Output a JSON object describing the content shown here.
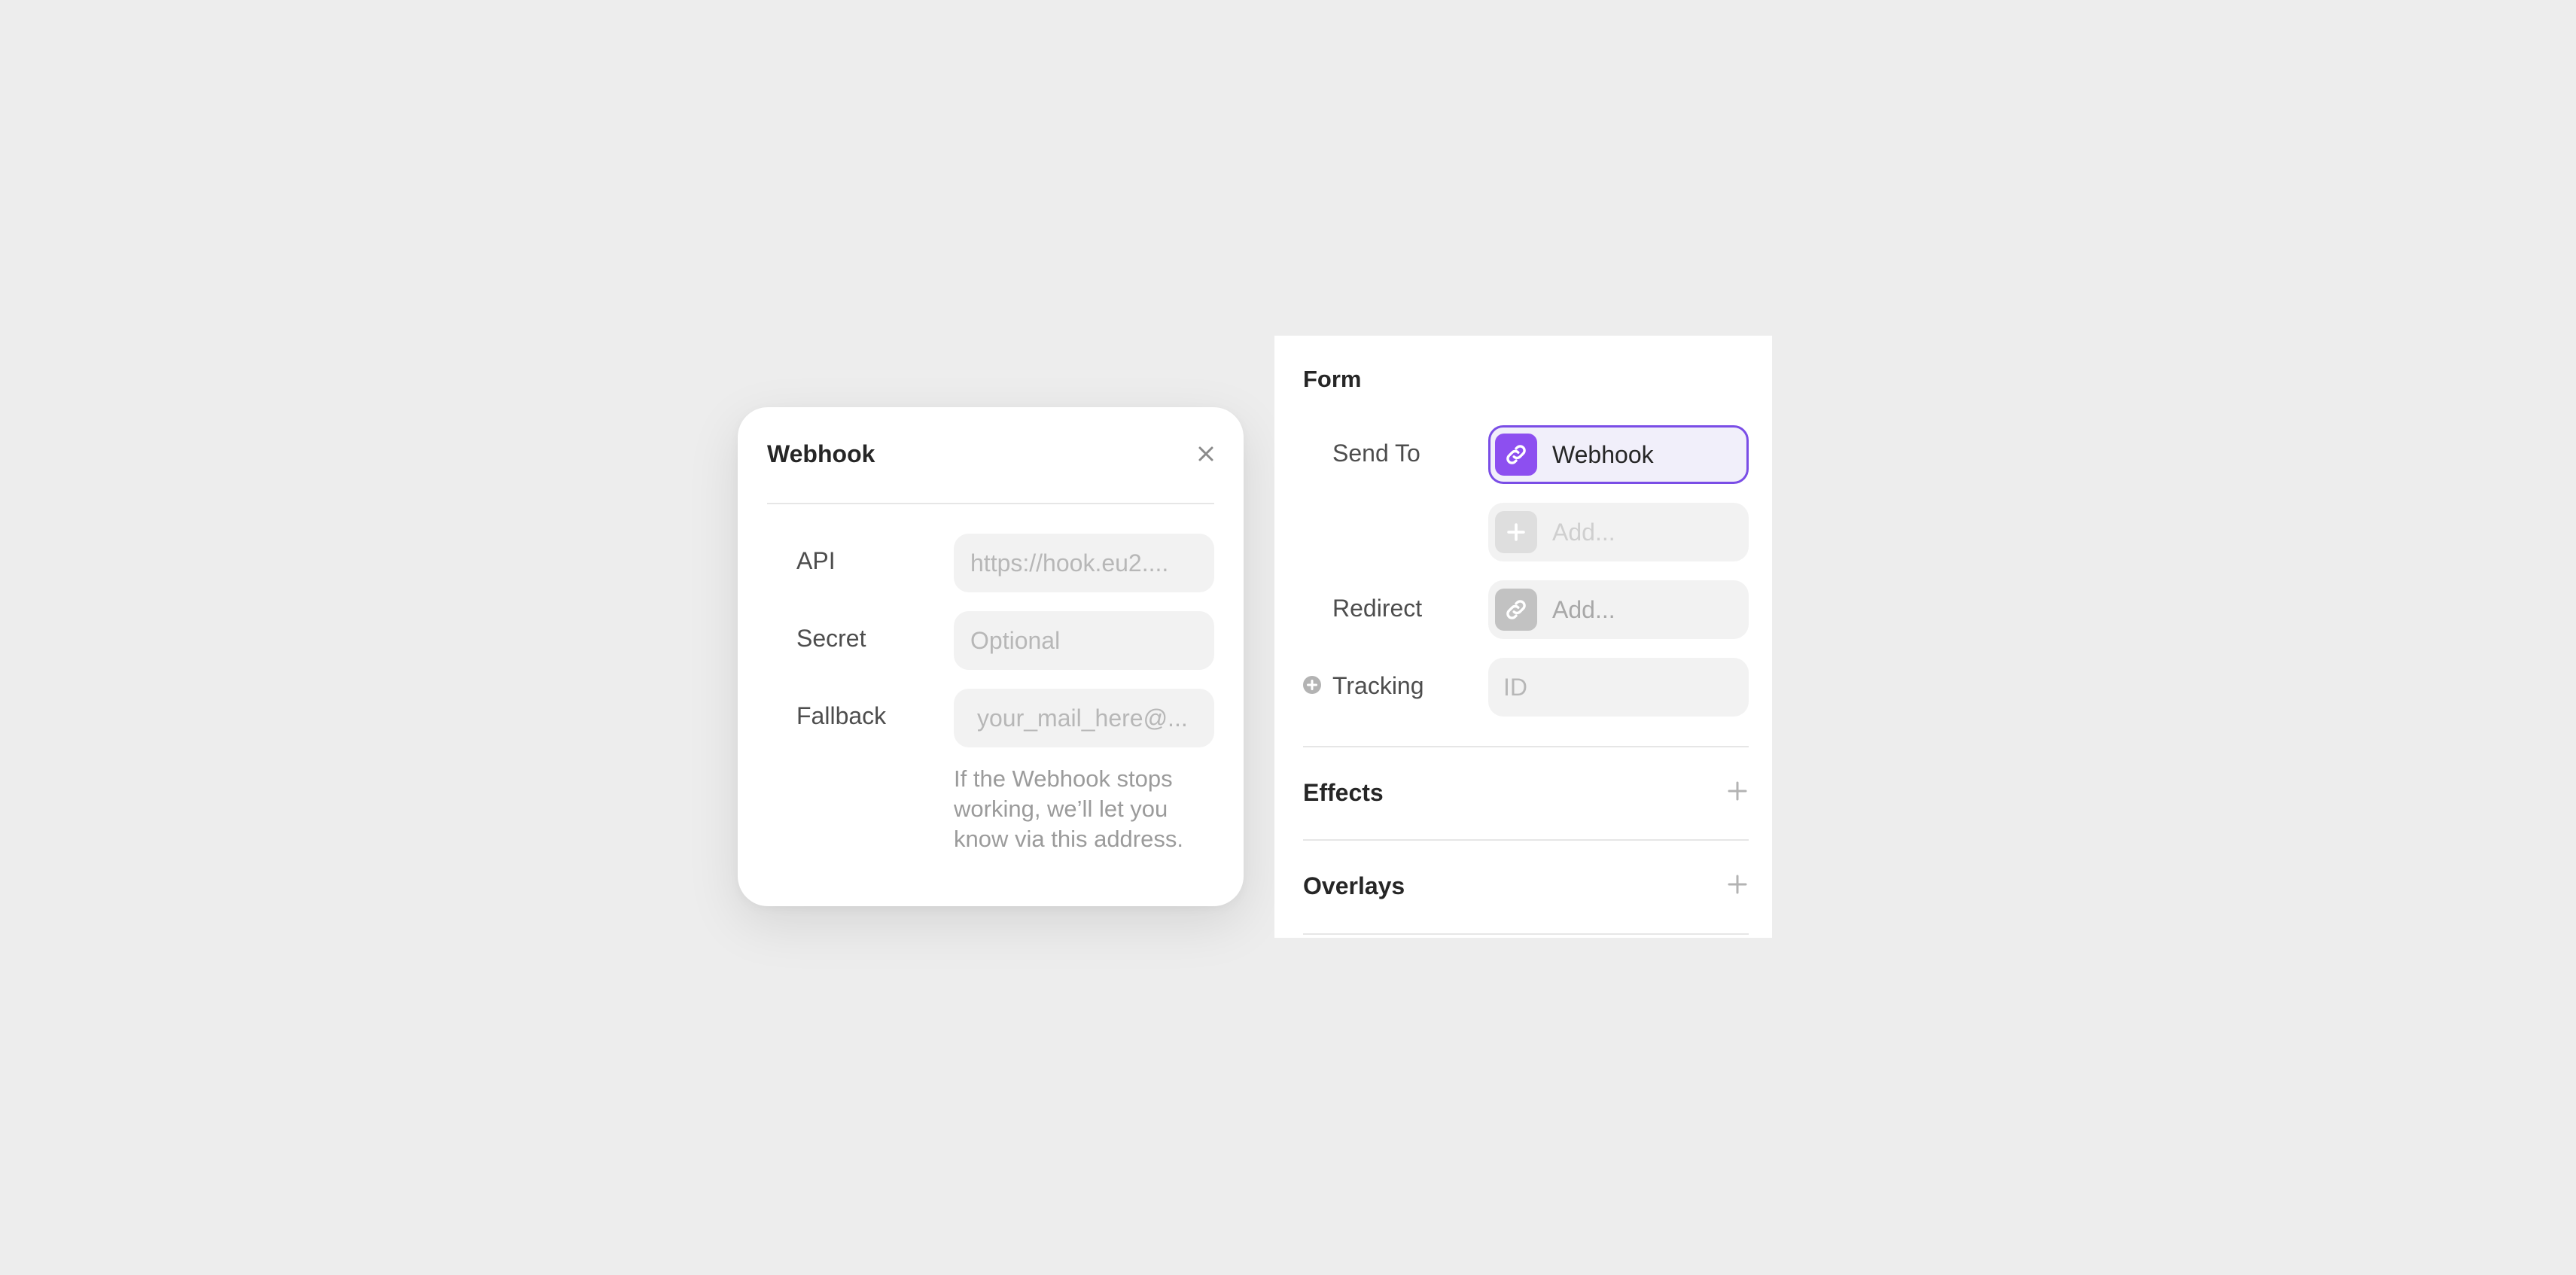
{
  "webhook_modal": {
    "title": "Webhook",
    "close_icon": "close-icon",
    "fields": [
      {
        "label": "API",
        "placeholder": "https://hook.eu2...."
      },
      {
        "label": "Secret",
        "placeholder": "Optional"
      },
      {
        "label": "Fallback",
        "placeholder": "your_mail_here@..."
      }
    ],
    "help_text": "If the Webhook stops working, we’ll let you know via this address."
  },
  "form_panel": {
    "title": "Form",
    "send_to": {
      "label": "Send To",
      "value": "Webhook",
      "icon": "link-icon",
      "add_placeholder": "Add...",
      "add_icon": "plus-icon"
    },
    "redirect": {
      "label": "Redirect",
      "placeholder": "Add...",
      "icon": "link-icon"
    },
    "tracking": {
      "label": "Tracking",
      "placeholder": "ID",
      "icon": "plus-circle-icon"
    },
    "sections": [
      {
        "title": "Effects",
        "icon": "plus-icon"
      },
      {
        "title": "Overlays",
        "icon": "plus-icon"
      }
    ]
  },
  "colors": {
    "background": "#ededed",
    "accent": "#8d4ff0",
    "accent_border": "#7a4de6",
    "field_bg": "#f2f2f2"
  }
}
